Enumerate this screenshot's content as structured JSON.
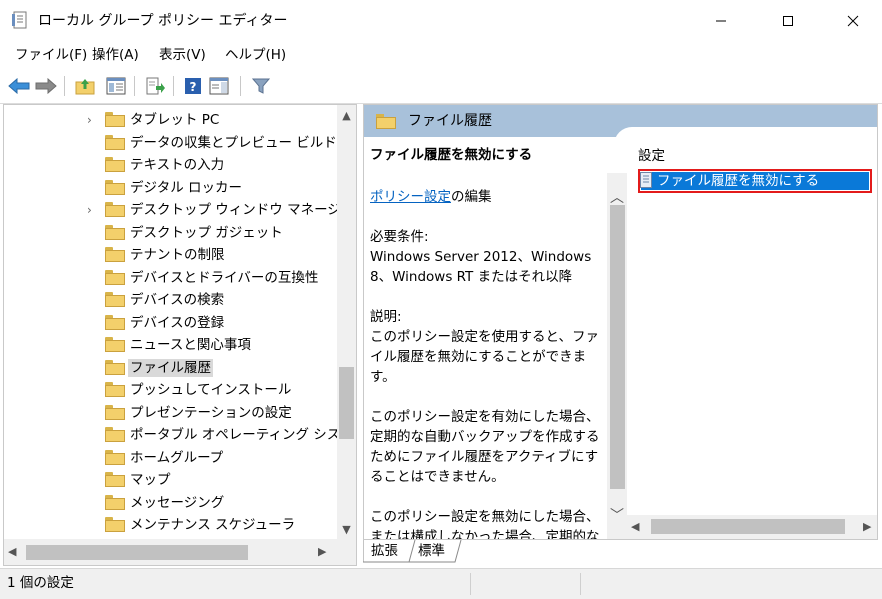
{
  "window": {
    "title": "ローカル グループ ポリシー エディター",
    "minimize_icon": "minimize-icon",
    "maximize_icon": "maximize-icon",
    "close_icon": "close-icon"
  },
  "menu": {
    "items": [
      "ファイル(F)",
      "操作(A)",
      "表示(V)",
      "ヘルプ(H)"
    ]
  },
  "toolbar": {
    "icons": [
      "back-arrow-icon",
      "forward-arrow-icon",
      "up-folder-icon",
      "show-hide-tree-icon",
      "export-list-icon",
      "help-icon",
      "properties-pane-icon",
      "filter-icon"
    ]
  },
  "tree": {
    "items": [
      {
        "label": "タブレット PC",
        "expandable": true
      },
      {
        "label": "データの収集とプレビュー ビルド",
        "expandable": false
      },
      {
        "label": "テキストの入力",
        "expandable": false
      },
      {
        "label": "デジタル ロッカー",
        "expandable": false
      },
      {
        "label": "デスクトップ ウィンドウ マネージャー",
        "expandable": true
      },
      {
        "label": "デスクトップ ガジェット",
        "expandable": false
      },
      {
        "label": "テナントの制限",
        "expandable": false
      },
      {
        "label": "デバイスとドライバーの互換性",
        "expandable": false
      },
      {
        "label": "デバイスの検索",
        "expandable": false
      },
      {
        "label": "デバイスの登録",
        "expandable": false
      },
      {
        "label": "ニュースと関心事項",
        "expandable": false
      },
      {
        "label": "ファイル履歴",
        "expandable": false,
        "selected": true
      },
      {
        "label": "プッシュしてインストール",
        "expandable": false
      },
      {
        "label": "プレゼンテーションの設定",
        "expandable": false
      },
      {
        "label": "ポータブル オペレーティング システム",
        "expandable": false
      },
      {
        "label": "ホームグループ",
        "expandable": false
      },
      {
        "label": "マップ",
        "expandable": false
      },
      {
        "label": "メッセージング",
        "expandable": false
      },
      {
        "label": "メンテナンス スケジューラ",
        "expandable": false
      },
      {
        "label": "",
        "expandable": false
      }
    ]
  },
  "details": {
    "header_title": "ファイル履歴",
    "policy_title": "ファイル履歴を無効にする",
    "edit_link": "ポリシー設定",
    "edit_suffix": "の編集",
    "requirements_label": "必要条件:",
    "requirements_value": "Windows Server 2012、Windows 8、Windows RT またはそれ以降",
    "description_label": "説明:",
    "description_p1": "このポリシー設定を使用すると、ファイル履歴を無効にすることができます。",
    "description_p2": "このポリシー設定を有効にした場合、定期的な自動バックアップを作成するためにファイル履歴をアクティブにすることはできません。",
    "description_p3": "このポリシー設定を無効にした場合、または構成しなかった場合、定期的な自動バックアップを作成するためにファイル履歴をアクティブにすることができます。"
  },
  "settings_list": {
    "header": "設定",
    "items": [
      {
        "label": "ファイル履歴を無効にする",
        "selected": true,
        "highlighted": true
      }
    ]
  },
  "tabs": [
    "拡張",
    "標準"
  ],
  "status": {
    "text": "1 個の設定"
  },
  "colors": {
    "selection": "#0a79d8",
    "highlight_border": "#e31b1b",
    "header_band": "#a8c1da",
    "link": "#0563c1"
  }
}
